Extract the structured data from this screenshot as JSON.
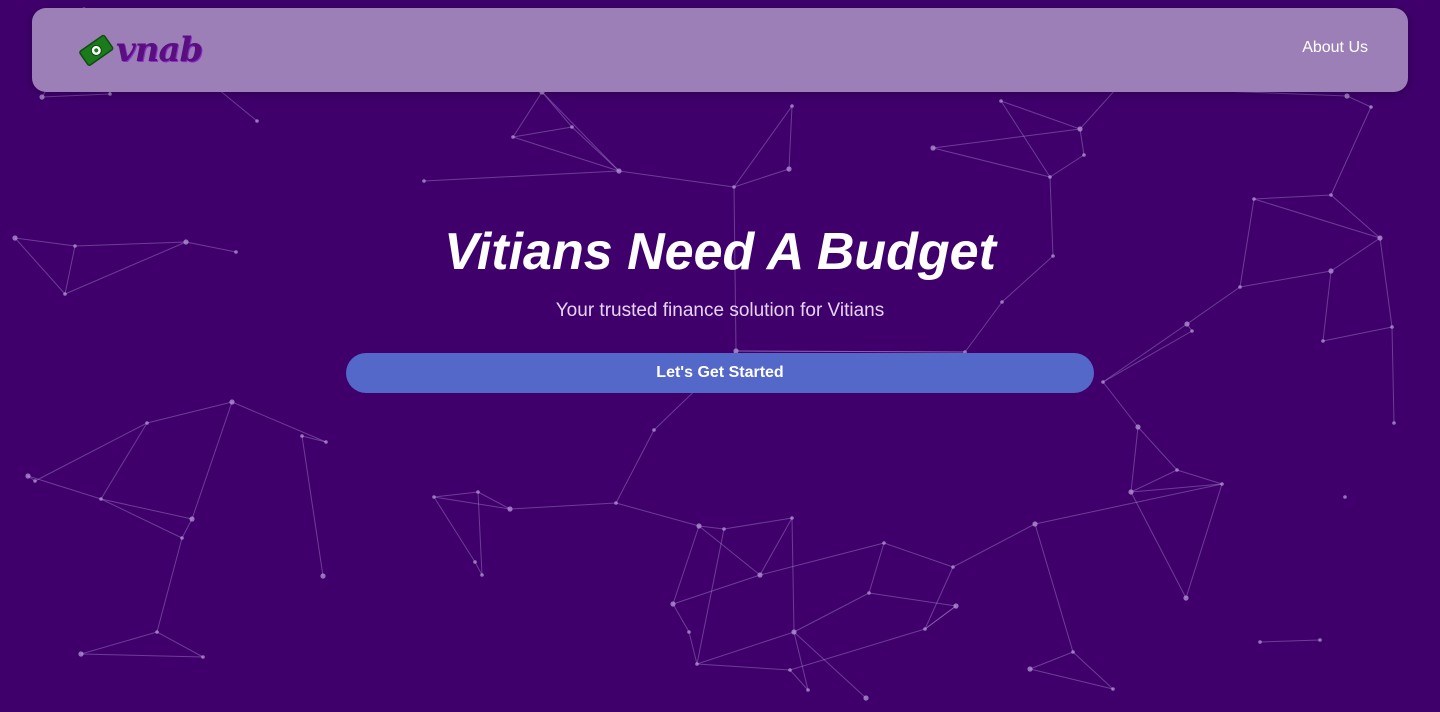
{
  "colors": {
    "background": "#3f006c",
    "navbar": "#9d7fb8",
    "button": "#5468c9",
    "network_lines": "#b497d6"
  },
  "navbar": {
    "logo": {
      "icon": "money-icon",
      "text": "vnab"
    },
    "links": [
      {
        "label": "About Us"
      }
    ]
  },
  "hero": {
    "title": "Vitians Need A Budget",
    "subtitle": "Your trusted finance solution for Vitians",
    "cta_label": "Let's Get Started"
  },
  "background": {
    "decoration": "particle-network"
  }
}
